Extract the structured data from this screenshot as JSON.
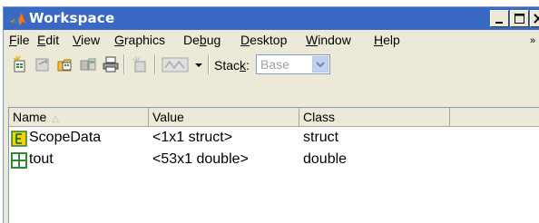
{
  "window": {
    "title": "Workspace",
    "title_icon": "matlab-logo-icon",
    "controls": [
      "minimize-icon",
      "maximize-icon",
      "close-icon"
    ]
  },
  "menubar": {
    "items": [
      {
        "label": "File",
        "mnemonic": "F"
      },
      {
        "label": "Edit",
        "mnemonic": "E"
      },
      {
        "label": "View",
        "mnemonic": "V"
      },
      {
        "label": "Graphics",
        "mnemonic": "G"
      },
      {
        "label": "Debug",
        "mnemonic": "b"
      },
      {
        "label": "Desktop",
        "mnemonic": "D"
      },
      {
        "label": "Window",
        "mnemonic": "W"
      },
      {
        "label": "Help",
        "mnemonic": "H"
      }
    ],
    "overflow": "»"
  },
  "toolbar": {
    "icons": [
      "new-variable-icon",
      "open-selection-icon",
      "import-data-icon",
      "save-icon",
      "print-icon",
      "delete-icon",
      "plot-selection-icon"
    ],
    "stack_label": "Stack:",
    "stack_mnemonic": "k",
    "stack_value": "Base"
  },
  "table": {
    "columns": [
      "Name",
      "Value",
      "Class"
    ],
    "sort_indicator": "△",
    "rows": [
      {
        "icon": "struct-icon",
        "name": "ScopeData",
        "value": "<1x1 struct>",
        "class": "struct"
      },
      {
        "icon": "matrix-icon",
        "name": "tout",
        "value": "<53x1 double>",
        "class": "double"
      }
    ]
  },
  "colors": {
    "titlebar": "#3a69c4",
    "chrome": "#ece9d8",
    "struct_icon": "#f2d400",
    "matrix_icon": "#2e8b2e"
  }
}
